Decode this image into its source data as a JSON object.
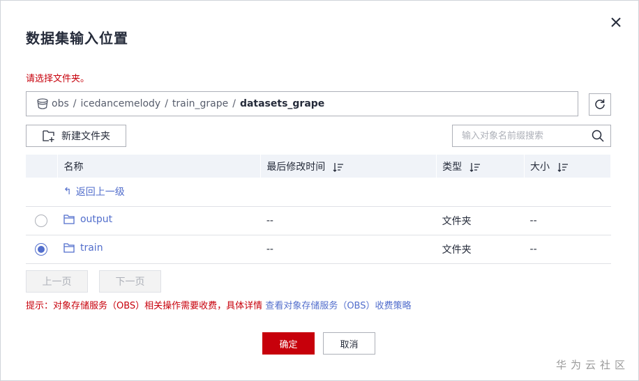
{
  "dialog": {
    "title": "数据集输入位置",
    "warning": "请选择文件夹。",
    "close_icon": "close-icon"
  },
  "path": {
    "bucket_icon": "bucket-icon",
    "segments": [
      "obs",
      "icedancemelody",
      "train_grape"
    ],
    "current": "datasets_grape",
    "separator": "/"
  },
  "toolbar": {
    "new_folder_label": "新建文件夹",
    "search_placeholder": "输入对象名前缀搜索"
  },
  "table": {
    "headers": [
      "名称",
      "最后修改时间",
      "类型",
      "大小"
    ],
    "back_label": "返回上一级",
    "rows": [
      {
        "name": "output",
        "modified": "--",
        "type": "文件夹",
        "size": "--",
        "selected": false
      },
      {
        "name": "train",
        "modified": "--",
        "type": "文件夹",
        "size": "--",
        "selected": true
      }
    ]
  },
  "pagination": {
    "prev_label": "上一页",
    "next_label": "下一页"
  },
  "tip": {
    "text": "提示：对象存储服务（OBS）相关操作需要收费，具体详情 ",
    "link": "查看对象存储服务（OBS）收费策略"
  },
  "footer": {
    "ok_label": "确定",
    "cancel_label": "取消"
  },
  "watermark": "华为云社区",
  "colors": {
    "accent": "#526ecc",
    "danger": "#c7000b",
    "header_bg": "#f0f3f8"
  }
}
